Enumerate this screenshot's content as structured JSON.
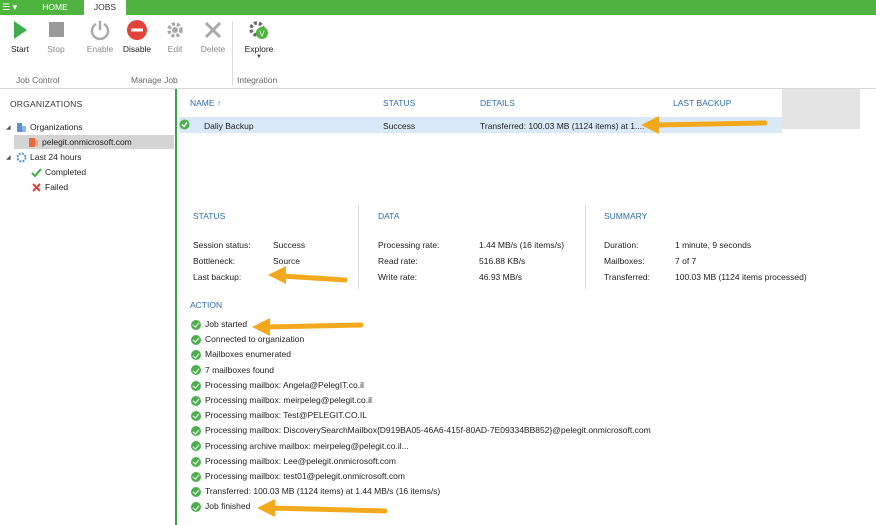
{
  "ribbon": {
    "tabs": {
      "home": "HOME",
      "jobs": "JOBS"
    },
    "buttons": {
      "start": "Start",
      "stop": "Stop",
      "enable": "Enable",
      "disable": "Disable",
      "edit": "Edit",
      "delete": "Delete",
      "explore": "Explore"
    },
    "groups": {
      "job_control": "Job Control",
      "manage_job": "Manage Job",
      "integration": "Integration"
    }
  },
  "nav": {
    "header": "ORGANIZATIONS",
    "organizations": "Organizations",
    "org_item": "pelegit.onmicrosoft.com",
    "last24": "Last 24 hours",
    "completed": "Completed",
    "failed": "Failed"
  },
  "grid": {
    "headers": {
      "name": "NAME ↑",
      "status": "STATUS",
      "details": "DETAILS",
      "last_backup": "LAST BACKUP"
    },
    "row": {
      "name": "Daliy Backup",
      "status": "Success",
      "details": "Transferred: 100.03 MB (1124 items) at 1...."
    }
  },
  "status": {
    "title": "STATUS",
    "session_label": "Session status:",
    "session_value": "Success",
    "bottleneck_label": "Bottleneck:",
    "bottleneck_value": "Source",
    "last_backup_label": "Last backup:"
  },
  "data": {
    "title": "DATA",
    "proc_label": "Processing rate:",
    "proc_value": "1.44 MB/s (16 items/s)",
    "read_label": "Read rate:",
    "read_value": "516.88 KB/s",
    "write_label": "Write rate:",
    "write_value": "46.93 MB/s"
  },
  "summary": {
    "title": "SUMMARY",
    "duration_label": "Duration:",
    "duration_value": "1 minute, 9 seconds",
    "mailboxes_label": "Mailboxes:",
    "mailboxes_value": "7 of 7",
    "transferred_label": "Transferred:",
    "transferred_value": "100.03 MB (1124 items processed)"
  },
  "action": {
    "title": "ACTION",
    "items": [
      "Job started",
      "Connected to organization",
      "Mailboxes enumerated",
      "7 mailboxes found",
      "Processing mailbox: Angela@PelegIT.co.il",
      "Processing mailbox: meirpeleg@pelegit.co.il",
      "Processing mailbox: Test@PELEGIT.CO.IL",
      "Processing mailbox: DiscoverySearchMailbox{D919BA05-46A6-415f-80AD-7E09334BB852}@pelegit.onmicrosoft.com",
      "Processing archive mailbox: meirpeleg@pelegit.co.il...",
      "Processing mailbox: Lee@pelegit.onmicrosoft.com",
      "Processing mailbox: test01@pelegit.onmicrosoft.com",
      "Transferred: 100.03 MB (1124 items) at 1.44 MB/s (16 items/s)",
      "Job finished"
    ]
  },
  "colors": {
    "accent_green": "#4fb43f",
    "header_blue": "#2f6ea8",
    "arrow_orange": "#f3a91d"
  }
}
